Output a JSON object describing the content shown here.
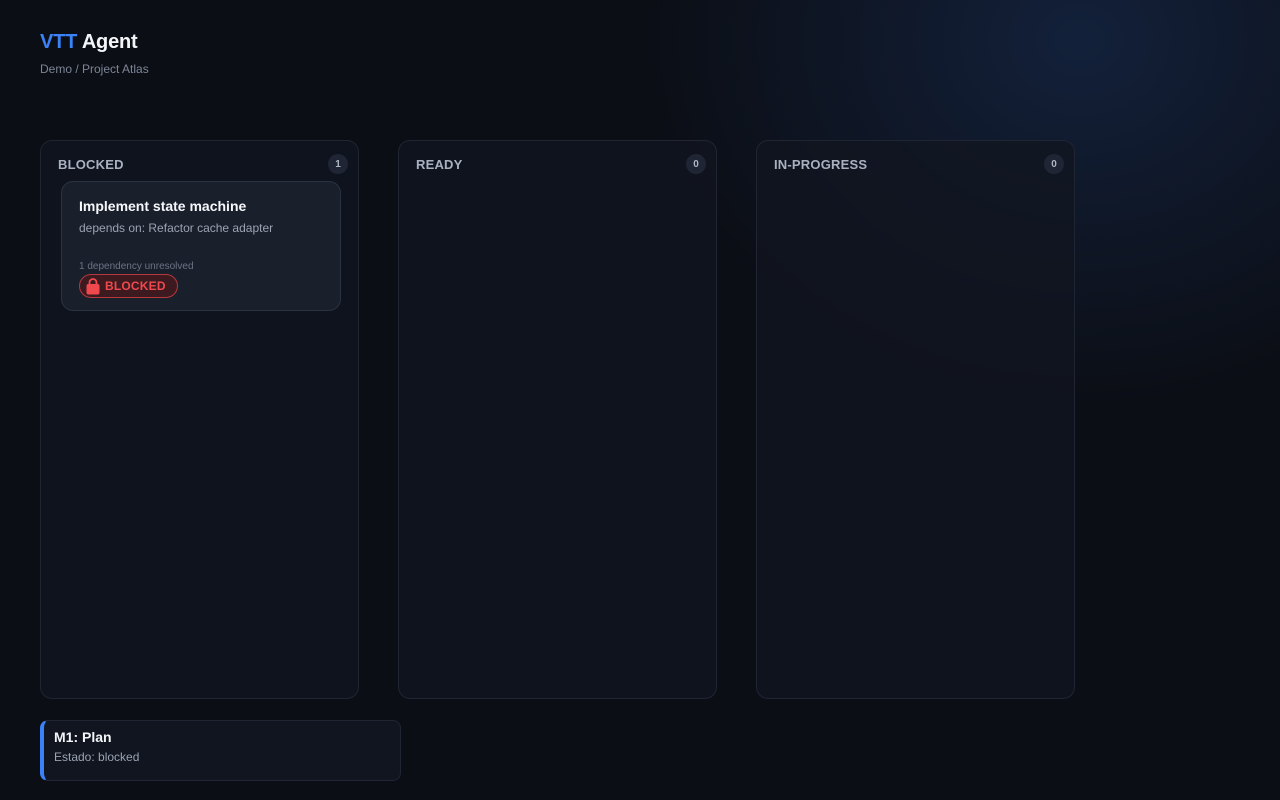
{
  "app": {
    "title_brand": "VTT",
    "title_rest": "Agent",
    "breadcrumb": "Demo / Project Atlas"
  },
  "columns": [
    {
      "title": "BLOCKED",
      "count": "1",
      "cards": [
        {
          "title": "Implement state machine",
          "depends": "depends on: Refactor cache adapter",
          "note": "1 dependency unresolved",
          "status_label": "BLOCKED",
          "status_icon": "lock-icon",
          "status_color": "#f0494d"
        }
      ]
    },
    {
      "title": "READY",
      "count": "0",
      "cards": []
    },
    {
      "title": "IN-PROGRESS",
      "count": "0",
      "cards": []
    }
  ],
  "milestone": {
    "title": "M1: Plan",
    "status": "Estado: blocked",
    "accent_color": "#3b82f6"
  },
  "colors": {
    "accent": "#3b82f6",
    "background": "#0b0e15",
    "blocked": "#f0494d"
  }
}
